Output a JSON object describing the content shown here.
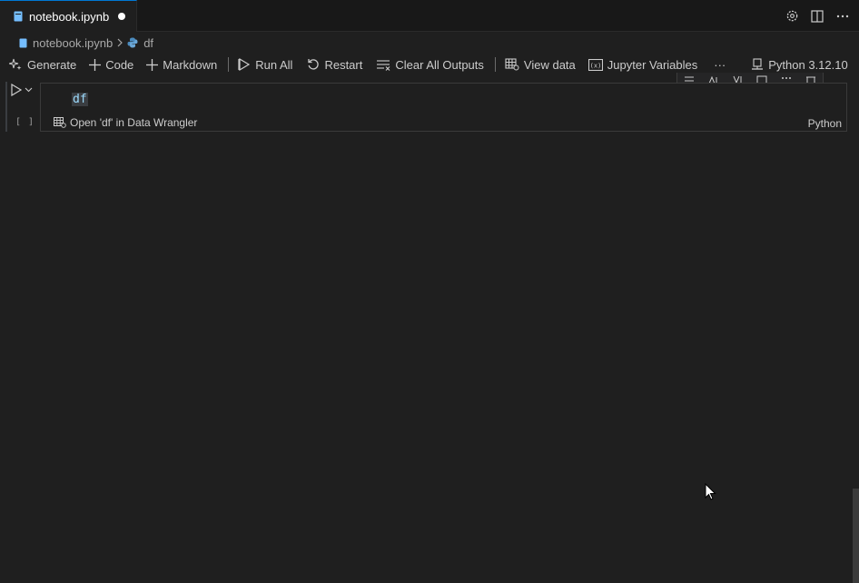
{
  "tab": {
    "title": "notebook.ipynb"
  },
  "breadcrumb": {
    "file": "notebook.ipynb",
    "symbol": "df"
  },
  "toolbar": {
    "generate": "Generate",
    "code": "Code",
    "markdown": "Markdown",
    "run_all": "Run All",
    "restart": "Restart",
    "clear_outputs": "Clear All Outputs",
    "view_data": "View data",
    "jupyter_variables": "Jupyter Variables",
    "more": "···",
    "kernel": "Python 3.12.10"
  },
  "cell": {
    "exec_count": "[ ]",
    "code": "df",
    "status_link": "Open 'df' in Data Wrangler",
    "language": "Python"
  },
  "colors": {
    "accent": "#0078d4",
    "background": "#1f1f1f",
    "tabbar": "#181818"
  }
}
